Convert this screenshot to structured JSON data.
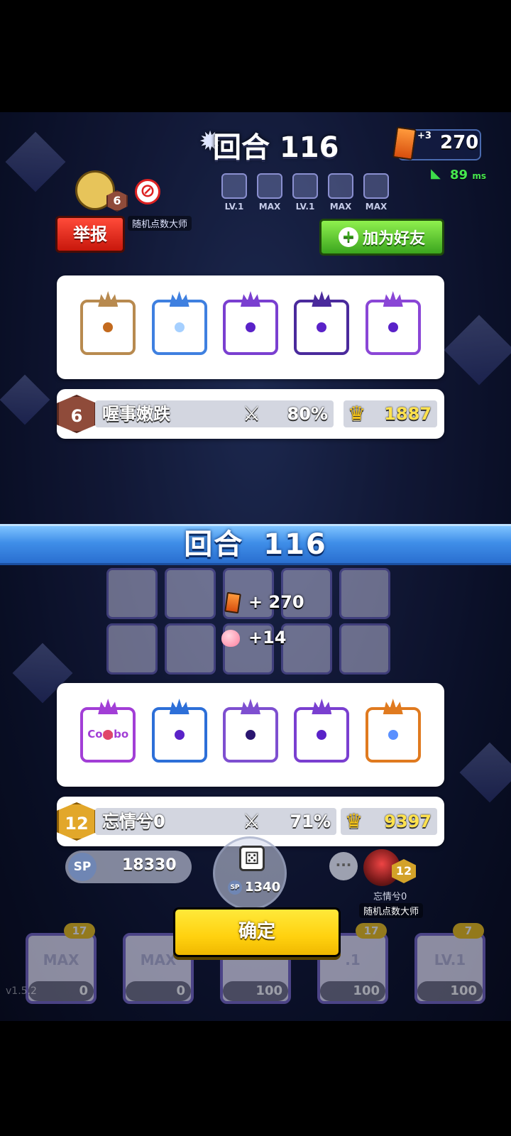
{
  "hud": {
    "round_label": "回合 116",
    "cards_plus": "+3",
    "cards": "270",
    "ping": "89",
    "ping_unit": "ms"
  },
  "opponent": {
    "rank": "6",
    "title": "随机点数大师",
    "report_label": "举报",
    "add_friend_label": "加为好友",
    "mini_slots": [
      "LV.1",
      "MAX",
      "LV.1",
      "MAX",
      "MAX"
    ],
    "name": "喔事嫩跌",
    "win_rate": "80%",
    "trophies": "1887",
    "dice": [
      {
        "name": "random",
        "border": "#b88a4f",
        "pip": "#c36a1e",
        "text": ""
      },
      {
        "name": "ice",
        "border": "#3f80e0",
        "pip": "#a6d0ff",
        "text": ""
      },
      {
        "name": "purple-crown",
        "border": "#7a3fd0",
        "pip": "#5a22c8",
        "text": ""
      },
      {
        "name": "moon",
        "border": "#4a2a9c",
        "pip": "#5a22c8",
        "text": ""
      },
      {
        "name": "target",
        "border": "#8a46d6",
        "pip": "#5a22c8",
        "text": ""
      }
    ]
  },
  "banner": {
    "word": "回合",
    "number": "116"
  },
  "rewards": {
    "cards": "+ 270",
    "peach": "+14"
  },
  "me": {
    "rank": "12",
    "name": "忘情兮0",
    "win_rate": "71%",
    "trophies": "9397",
    "title": "随机点数大师",
    "sp": "18330",
    "roll_cost": "1340",
    "dice": [
      {
        "name": "combo",
        "border": "#a23ed6",
        "pip": "#e0466a",
        "text": "Combo"
      },
      {
        "name": "moon-blue",
        "border": "#2d6fd8",
        "pip": "#5a22c8",
        "text": ""
      },
      {
        "name": "crack",
        "border": "#7e4fd0",
        "pip": "#2a1670",
        "text": ""
      },
      {
        "name": "growth",
        "border": "#7a3fd0",
        "pip": "#5a22c8",
        "text": ""
      },
      {
        "name": "infinity",
        "border": "#e07a1f",
        "pip": "#5a90ff",
        "text": ""
      }
    ]
  },
  "confirm_label": "确定",
  "deck": [
    {
      "level": "MAX",
      "count": "17",
      "cost": "0"
    },
    {
      "level": "MAX",
      "count": "",
      "cost": "0"
    },
    {
      "level": "",
      "count": "",
      "cost": "100"
    },
    {
      "level": ".1",
      "count": "17",
      "cost": "100"
    },
    {
      "level": "LV.1",
      "count": "7",
      "cost": "100"
    }
  ],
  "version": "v1.5.2"
}
